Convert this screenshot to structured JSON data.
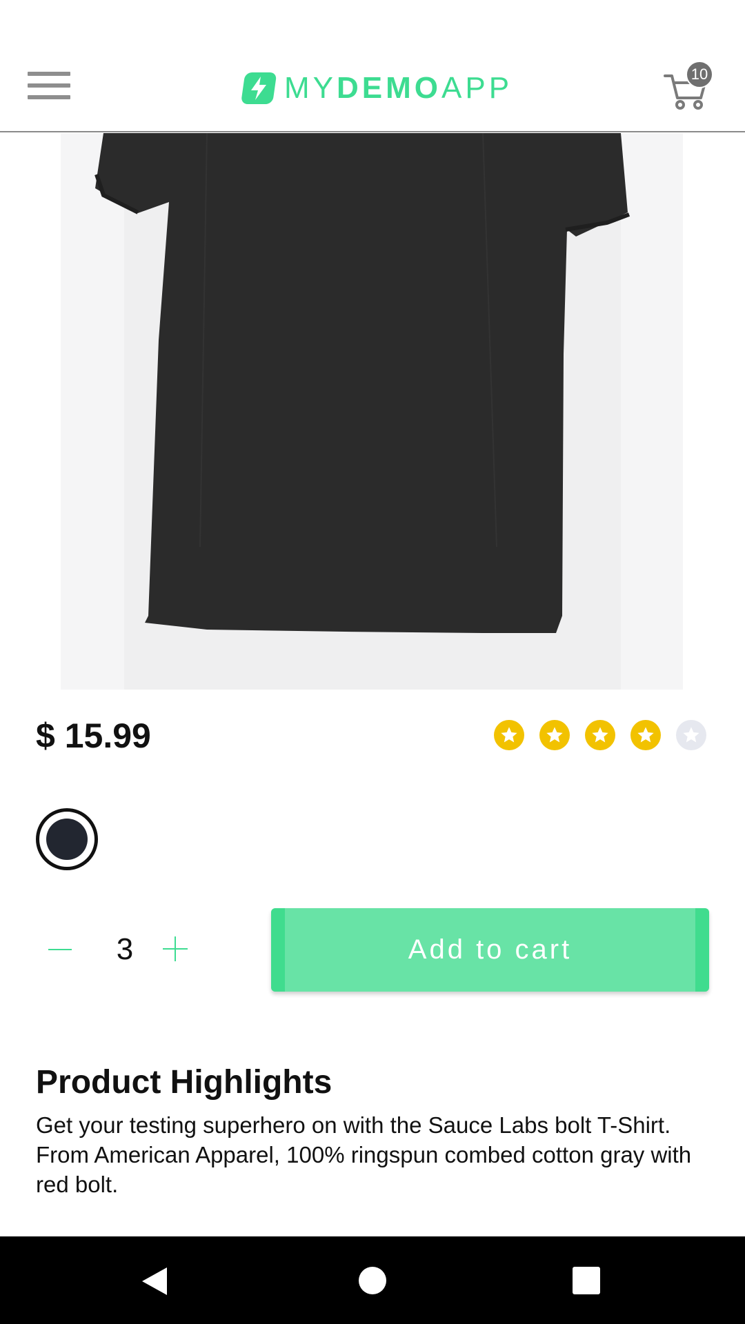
{
  "header": {
    "logo_part1": "MY",
    "logo_part2": "DEMO",
    "logo_part3": "APP",
    "cart_count": "10"
  },
  "product": {
    "price": "$ 15.99",
    "rating": 4,
    "rating_max": 5,
    "color_selected": "#222630",
    "quantity": "3",
    "add_to_cart_label": "Add to cart",
    "highlights_title": "Product Highlights",
    "highlights_text": "Get your testing superhero on with the Sauce Labs bolt T-Shirt. From American Apparel, 100% ringspun combed cotton gray with red bolt."
  },
  "colors": {
    "accent": "#3ddc91",
    "button": "#68e3a6",
    "star": "#f2c200"
  }
}
